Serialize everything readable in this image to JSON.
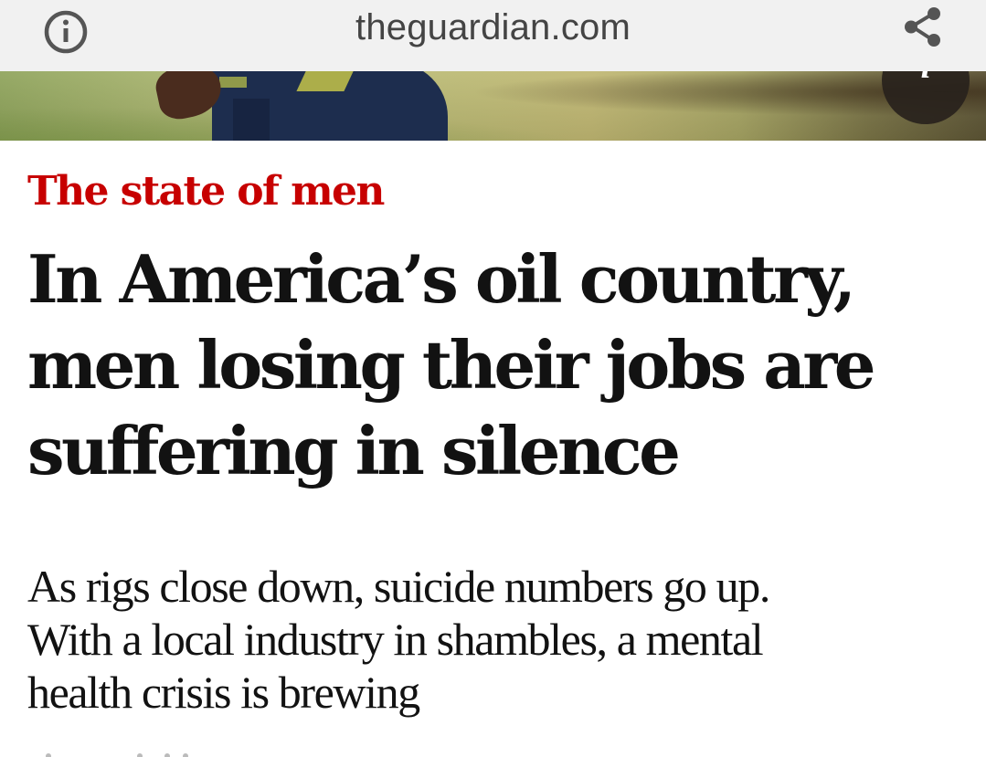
{
  "browser": {
    "domain": "theguardian.com",
    "info_icon": "info-circle-icon",
    "share_icon": "share-icon"
  },
  "hero": {
    "caption_button_glyph": "i",
    "caption_icon": "caption-info-icon"
  },
  "article": {
    "kicker": "The state of men",
    "kicker_color": "#c70000",
    "headline_lines": [
      "In America’s oil country,",
      "men losing their jobs are",
      "suffering in silence"
    ],
    "standfirst_lines": [
      "As rigs close down, suicide numbers go up.",
      "With a local industry in shambles, a mental",
      "health crisis is brewing"
    ]
  }
}
